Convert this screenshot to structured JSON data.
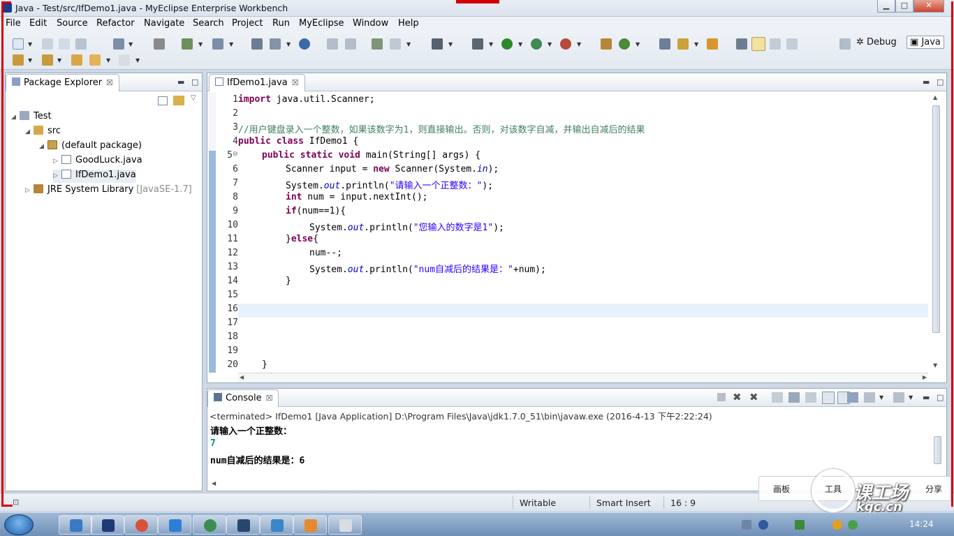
{
  "window": {
    "title": "Java - Test/src/IfDemo1.java - MyEclipse Enterprise Workbench",
    "min_glyph": "▁",
    "max_glyph": "□",
    "close_glyph": "✕"
  },
  "menu": [
    "File",
    "Edit",
    "Source",
    "Refactor",
    "Navigate",
    "Search",
    "Project",
    "Run",
    "MyEclipse",
    "Window",
    "Help"
  ],
  "perspectives": {
    "debug": "Debug",
    "java": "Java"
  },
  "package_explorer": {
    "tab_label": "Package Explorer",
    "close_glyph": "☒",
    "tree": {
      "project": "Test",
      "src": "src",
      "package": "(default package)",
      "files": [
        "GoodLuck.java",
        "IfDemo1.java"
      ],
      "jre": "JRE System Library",
      "jre_version": "[JavaSE-1.7]"
    }
  },
  "editor": {
    "tab_label": "IfDemo1.java",
    "close_glyph": "☒",
    "line_numbers": [
      "1",
      "2",
      "3",
      "4",
      "5",
      "6",
      "7",
      "8",
      "9",
      "10",
      "11",
      "12",
      "13",
      "14",
      "15",
      "16",
      "17",
      "18",
      "19",
      "20"
    ],
    "fold_marker": "⊖",
    "current_line": 16,
    "code": {
      "l1_kw": "import",
      "l1_rest": " java.util.Scanner;",
      "l3_comment": "//用户键盘录入一个整数，如果该数字为1，则直接输出。否则，对该数字自减，并输出自减后的结果",
      "l4_kw": "public class",
      "l4_rest": " IfDemo1 {",
      "l5_kw": "public static void",
      "l5_rest": " main(String[] args) {",
      "l6_a": "Scanner input = ",
      "l6_kw": "new",
      "l6_b": " Scanner(System.",
      "l6_field": "in",
      "l6_c": ");",
      "l7_a": "System.",
      "l7_field": "out",
      "l7_b": ".println(",
      "l7_str": "\"请输入一个正整数：\"",
      "l7_c": ");",
      "l8_kw": "int",
      "l8_rest": " num = input.nextInt();",
      "l9_kw": "if",
      "l9_rest": "(num==1){",
      "l10_a": "System.",
      "l10_field": "out",
      "l10_b": ".println(",
      "l10_str": "\"您输入的数字是1\"",
      "l10_c": ");",
      "l11_a": "}",
      "l11_kw": "else",
      "l11_b": "{",
      "l12": "num--;",
      "l13_a": "System.",
      "l13_field": "out",
      "l13_b": ".println(",
      "l13_str": "\"num自减后的结果是：\"",
      "l13_c": "+num);",
      "l14": "}",
      "l20": "}"
    }
  },
  "console": {
    "tab_label": "Console",
    "close_glyph": "☒",
    "status": "<terminated> IfDemo1 [Java Application] D:\\Program Files\\Java\\jdk1.7.0_51\\bin\\javaw.exe (2016-4-13 下午2:22:24)",
    "output": [
      "请输入一个正整数：",
      "7",
      "num自减后的结果是：6"
    ]
  },
  "statusbar": {
    "writable": "Writable",
    "insert_mode": "Smart Insert",
    "position": "16 : 9"
  },
  "overlay": {
    "draw_board": "画板",
    "tools": "工具",
    "share": "分享",
    "brand": "课工场",
    "domain": "kgc.cn"
  },
  "taskbar": {
    "clock": "14:24"
  },
  "colors": {
    "keyword": "#7f0055",
    "string": "#2a00ff",
    "field": "#0000c0",
    "comment": "#3f7f5f",
    "current_line": "#e8f2fe",
    "console_input": "#009966"
  },
  "icons": [
    "app-icon",
    "package-explorer-icon",
    "java-file-icon",
    "console-icon",
    "project-icon",
    "src-folder-icon",
    "package-icon",
    "jre-library-icon",
    "start-orb-icon"
  ]
}
